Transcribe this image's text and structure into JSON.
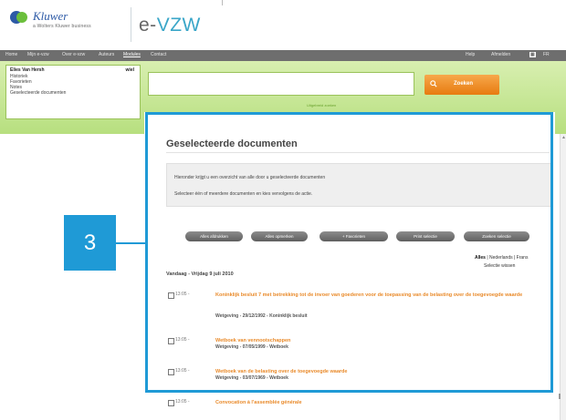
{
  "header": {
    "logo_text": "Kluwer",
    "logo_sub": "a Wolters Kluwer business",
    "brand_e": "e-",
    "brand_rest": "VZW"
  },
  "nav": {
    "left_items": [
      "Home",
      "Mijn e-vzw",
      "Over e-vzw",
      "Auteurs",
      "Modules",
      "Contact"
    ],
    "right_items": [
      "Help",
      "Afmelden",
      "FR"
    ]
  },
  "user_panel": {
    "name": "Elies Van Hersh",
    "edit": "wiel",
    "links": [
      "Historiek",
      "Favorieten",
      "Notes",
      "Geselecteerde documenten"
    ]
  },
  "search": {
    "value": "",
    "subtext": "Uitgebreid zoeken",
    "button_label": "Zoeken"
  },
  "content": {
    "title": "Geselecteerde documenten",
    "info_line_1": "Hieronder krijgt u een overzicht van alle door u geselecteerde documenten",
    "info_line_2": "Selecteer één of meerdere documenten en kies vervolgens de actie.",
    "actions": [
      "Alles afdrukken",
      "Alles opmerken",
      "+ Favorieten",
      "Print selectie",
      "Zoeken selectie"
    ],
    "lang_filter": {
      "active": "Alles",
      "others": " | Nederlands | Frans"
    },
    "reset_label": "Selectie wissen",
    "date_heading": "Vandaag - Vrijdag 9 juli 2010",
    "documents": [
      {
        "time": "13:05 -",
        "title": "Koninklijk besluit 7 met betrekking tot de invoer van goederen voor de toepassing van de belasting over de toegevoegde waarde",
        "meta": "Wetgeving - 29/12/1992 - Koninklijk besluit"
      },
      {
        "time": "13:05 -",
        "title": "Wetboek van vennootschappen",
        "meta": "Wetgeving - 07/05/1999 - Wetboek"
      },
      {
        "time": "13:05 -",
        "title": "Wetboek van de belasting over de toegevoegde waarde",
        "meta": "Wetgeving - 03/07/1969 - Wetboek"
      },
      {
        "time": "13:05 -",
        "title": "Convocation à l'assemblée générale",
        "meta": ""
      }
    ]
  },
  "callout": {
    "number": "3"
  },
  "colors": {
    "accent_blue": "#1f9ad6",
    "orange": "#e98a2a",
    "green": "#b7df7f",
    "nav_gray": "#6e6e6e"
  }
}
